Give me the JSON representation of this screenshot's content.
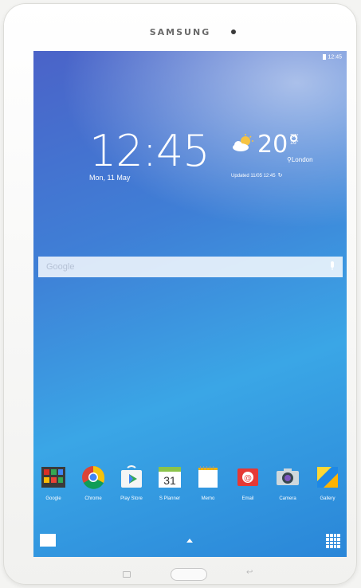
{
  "device": {
    "brand": "SAMSUNG"
  },
  "status_bar": {
    "time": "12:45"
  },
  "lock_widget": {
    "time": "12:45",
    "date": "Mon, 11 May"
  },
  "weather": {
    "icon": "partly-cloudy-icon",
    "temp": "20°",
    "high": "24°",
    "low": "16°",
    "city": "London",
    "updated": "Updated 11/05 12:45"
  },
  "search": {
    "label": "Google"
  },
  "dock": {
    "apps": [
      {
        "label": "Google",
        "icon": "google-folder-icon"
      },
      {
        "label": "Chrome",
        "icon": "chrome-icon"
      },
      {
        "label": "Play Store",
        "icon": "play-store-icon"
      },
      {
        "label": "S Planner",
        "icon": "calendar-icon",
        "date": "31"
      },
      {
        "label": "Memo",
        "icon": "memo-icon"
      },
      {
        "label": "Email",
        "icon": "email-icon"
      },
      {
        "label": "Camera",
        "icon": "camera-icon"
      },
      {
        "label": "Gallery",
        "icon": "gallery-icon"
      }
    ]
  },
  "colors": {
    "screen_top": "#4b63c8",
    "screen_bottom": "#2a86d8"
  }
}
